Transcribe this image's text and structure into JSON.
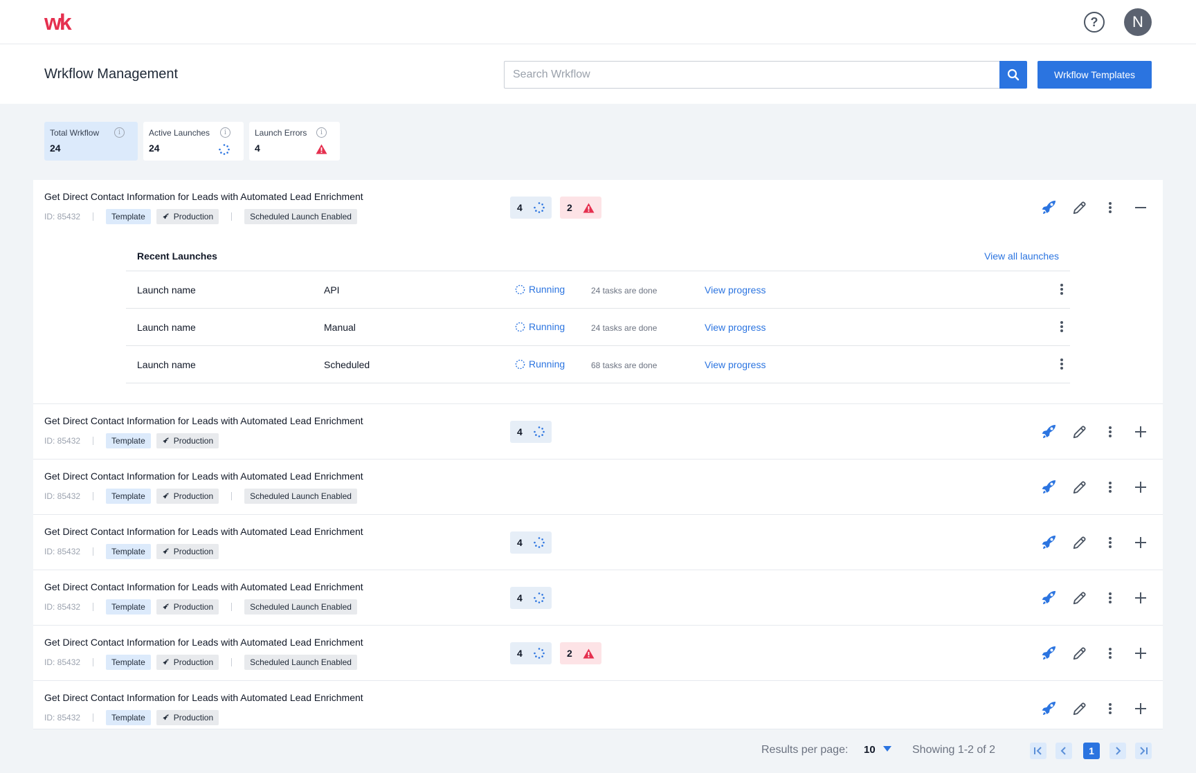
{
  "app": {
    "logo_text": "wk",
    "avatar_initial": "N"
  },
  "header": {
    "title": "Wrkflow Management",
    "search_placeholder": "Search Wrkflow",
    "templates_button": "Wrkflow Templates"
  },
  "stats": [
    {
      "label": "Total Wrkflow",
      "value": "24"
    },
    {
      "label": "Active Launches",
      "value": "24"
    },
    {
      "label": "Launch Errors",
      "value": "4"
    }
  ],
  "workflow_title": "Get Direct Contact Information for Leads with Automated Lead Enrichment",
  "id_text": "ID:  85432",
  "tags": {
    "template": "Template",
    "production": "Production",
    "scheduled": "Scheduled Launch Enabled"
  },
  "rows": [
    {
      "running": "4",
      "errors": "2"
    },
    {
      "running": "4"
    },
    {},
    {
      "running": "4"
    },
    {
      "running": "4"
    },
    {
      "running": "4",
      "errors": "2"
    },
    {}
  ],
  "launches": {
    "title": "Recent Launches",
    "view_all": "View all launches",
    "items": [
      {
        "name": "Launch name",
        "type": "API",
        "status": "Running",
        "tasks": "24 tasks are done",
        "action": "View progress"
      },
      {
        "name": "Launch name",
        "type": "Manual",
        "status": "Running",
        "tasks": "24 tasks are done",
        "action": "View progress"
      },
      {
        "name": "Launch name",
        "type": "Scheduled",
        "status": "Running",
        "tasks": "68 tasks are done",
        "action": "View progress"
      }
    ]
  },
  "pagination": {
    "per_page_label": "Results per page:",
    "per_page_value": "10",
    "showing": "Showing 1-2 of 2",
    "current_page": "1"
  },
  "colors": {
    "accent": "#2b74e0",
    "error": "#e5304f",
    "logo": "#e5304f"
  }
}
